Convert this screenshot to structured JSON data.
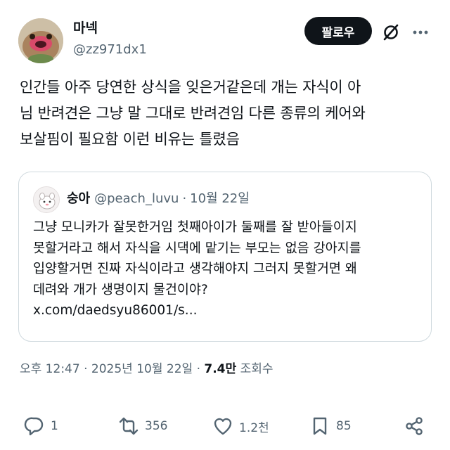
{
  "header": {
    "display_name": "마넥",
    "handle": "@zz971dx1",
    "follow_label": "팔로우",
    "grok_icon": "grok-slash-icon",
    "more_icon": "more-dots-icon"
  },
  "tweet": {
    "text": "인간들 아주 당연한 상식을 잊은거같은데 개는 자식이 아\n님 반려견은 그냥 말 그대로 반려견임 다른 종류의 케어와\n보살핌이 필요함 이런 비유는 틀렸음"
  },
  "quote": {
    "name": "숭아",
    "handle": "@peach_luvu",
    "separator": "·",
    "date": "10월 22일",
    "text": "그냥 모니카가 잘못한거임 첫째아이가 둘째를 잘 받아들이지\n못할거라고 해서 자식을 시댁에 맡기는 부모는 없음 강아지를\n입양할거면 진짜 자식이라고 생각해야지 그러지 못할거면 왜\n데려와 개가 생명이지 물건이야?\nx.com/daedsyu86001/s..."
  },
  "meta": {
    "time": "오후 12:47",
    "dot1": "·",
    "date": "2025년 10월 22일",
    "dot2": "·",
    "views_count": "7.4만",
    "views_label": "조회수"
  },
  "actions": {
    "reply_count": "1",
    "retweet_count": "356",
    "like_count": "1.2천",
    "bookmark_count": "85"
  },
  "colors": {
    "text": "#0f1419",
    "secondary": "#536471",
    "border": "#cfd9de",
    "button_bg": "#0f1419"
  }
}
